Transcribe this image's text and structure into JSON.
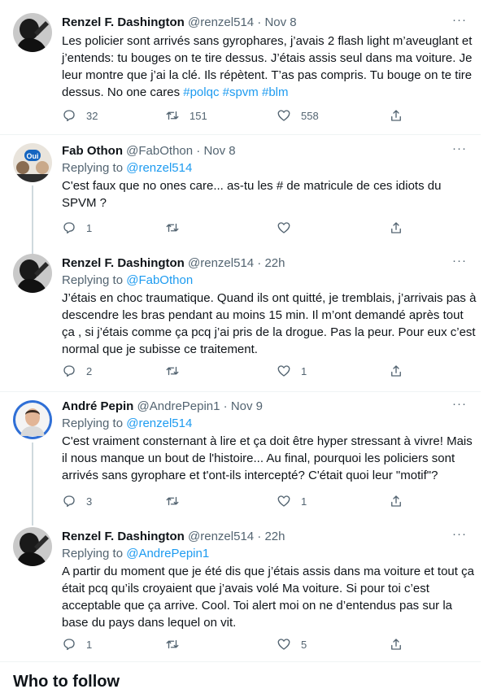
{
  "tweets": [
    {
      "name": "Renzel F. Dashington",
      "handle": "@renzel514",
      "time": "Nov 8",
      "replying_label": "",
      "replying_to": "",
      "text": "Les policier sont arrivés sans gyrophares, j’avais 2 flash light m’aveuglant et j’entends: tu bouges on te tire dessus. J’étais assis seul dans ma voiture. Je leur montre que j’ai la clé. Ils répètent. T’as pas compris.  Tu bouge on te tire dessus. No one cares ",
      "hashtags": [
        "#polqc",
        "#spvm",
        "#blm"
      ],
      "replies": "32",
      "retweets": "151",
      "likes": "558"
    },
    {
      "name": "Fab Othon",
      "handle": "@FabOthon",
      "time": "Nov 8",
      "replying_label": "Replying to",
      "replying_to": "@renzel514",
      "text": "C'est faux que no ones care... as-tu les # de matricule de ces idiots du SPVM ?",
      "replies": "1",
      "retweets": "",
      "likes": "",
      "avatar_badge": "Oui"
    },
    {
      "name": "Renzel F. Dashington",
      "handle": "@renzel514",
      "time": "22h",
      "replying_label": "Replying to",
      "replying_to": "@FabOthon",
      "text": "J’étais en choc traumatique. Quand ils ont quitté, je tremblais, j’arrivais pas à descendre les bras pendant au moins 15 min.  Il m’ont demandé après tout ça ,  si  j’étais comme ça pcq j’ai pris de la drogue. Pas la peur.  Pour eux c’est normal que je subisse ce traitement.",
      "replies": "2",
      "retweets": "",
      "likes": "1"
    },
    {
      "name": "André Pepin",
      "handle": "@AndrePepin1",
      "time": "Nov 9",
      "replying_label": "Replying to",
      "replying_to": "@renzel514",
      "text": "C'est vraiment consternant à lire et ça doit être hyper stressant à vivre! Mais il nous manque un bout de l'histoire... Au final, pourquoi les policiers sont arrivés sans gyrophare et t'ont-ils intercepté? C'était quoi leur \"motif\"?",
      "replies": "3",
      "retweets": "",
      "likes": "1"
    },
    {
      "name": "Renzel F. Dashington",
      "handle": "@renzel514",
      "time": "22h",
      "replying_label": "Replying to",
      "replying_to": "@AndrePepin1",
      "text": "A partir du moment que je été dis que j’étais assis dans ma voiture et tout ça était pcq qu’ils croyaient que j’avais volé Ma voiture.  Si pour toi c’est acceptable que ça arrive.  Cool. Toi alert moi on ne d’entendus pas sur la base du pays dans lequel on vit.",
      "replies": "1",
      "retweets": "",
      "likes": "5"
    }
  ],
  "separator": "·",
  "more_glyph": "···",
  "who_to_follow": "Who to follow",
  "colors": {
    "link": "#1d9bf0",
    "secondary": "#536471",
    "text": "#0f1419",
    "thread_line": "#cfd9de"
  }
}
